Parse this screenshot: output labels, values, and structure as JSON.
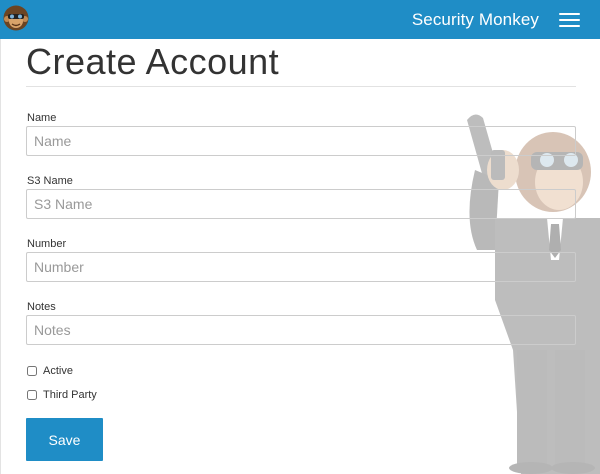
{
  "header": {
    "brand": "Security Monkey",
    "logo_icon": "monkey-logo-icon",
    "menu_icon": "hamburger-menu-icon",
    "accent_color": "#1f8dc6"
  },
  "page": {
    "title": "Create Account"
  },
  "form": {
    "fields": [
      {
        "label": "Name",
        "placeholder": "Name",
        "value": ""
      },
      {
        "label": "S3 Name",
        "placeholder": "S3 Name",
        "value": ""
      },
      {
        "label": "Number",
        "placeholder": "Number",
        "value": ""
      },
      {
        "label": "Notes",
        "placeholder": "Notes",
        "value": ""
      }
    ],
    "checkboxes": [
      {
        "label": "Active",
        "checked": false
      },
      {
        "label": "Third Party",
        "checked": false
      }
    ],
    "save_label": "Save"
  },
  "background": {
    "watermark_icon": "security-monkey-watermark"
  }
}
